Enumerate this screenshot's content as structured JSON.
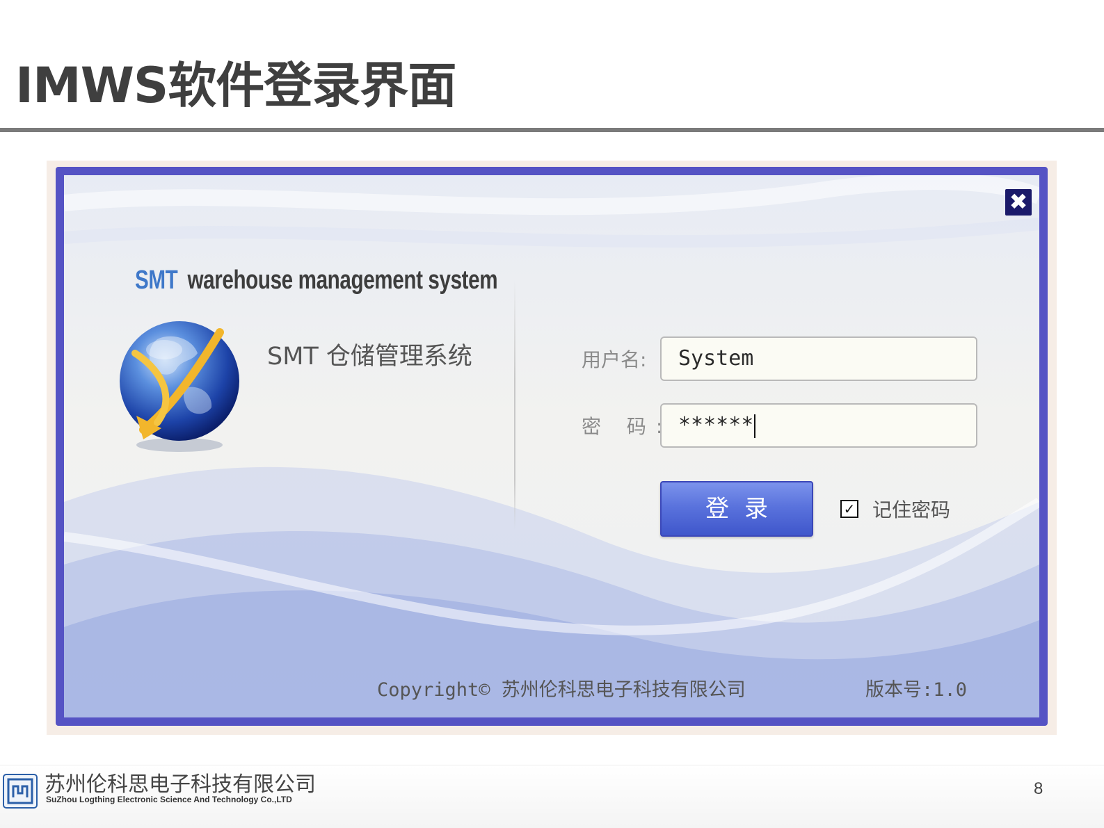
{
  "slide": {
    "title": "IMWS软件登录界面",
    "page_number": "8"
  },
  "dialog": {
    "brand_prefix": "SMT",
    "brand_suffix": "warehouse management system",
    "product_name_cn": "SMT  仓储管理系统",
    "close_label": "✖",
    "username_label": "用户名:",
    "username_value": "System",
    "password_label": "密 码:",
    "password_value": "******",
    "login_label": "登录",
    "remember_label": "记住密码",
    "remember_checked": true,
    "copyright": "Copyright© 苏州伦科思电子科技有限公司",
    "version": "版本号:1.0"
  },
  "footer": {
    "company_cn": "苏州伦科思电子科技有限公司",
    "company_en": "SuZhou Logthing Electronic Science And Technology Co.,LTD"
  },
  "colors": {
    "frame_border": "#5553c4",
    "brand_blue": "#3f78c9",
    "button_blue": "#5a73dd",
    "close_bg": "#1b1a6a"
  },
  "icons": [
    "globe-icon",
    "close-icon",
    "checkbox-check-icon",
    "company-logo-icon"
  ]
}
